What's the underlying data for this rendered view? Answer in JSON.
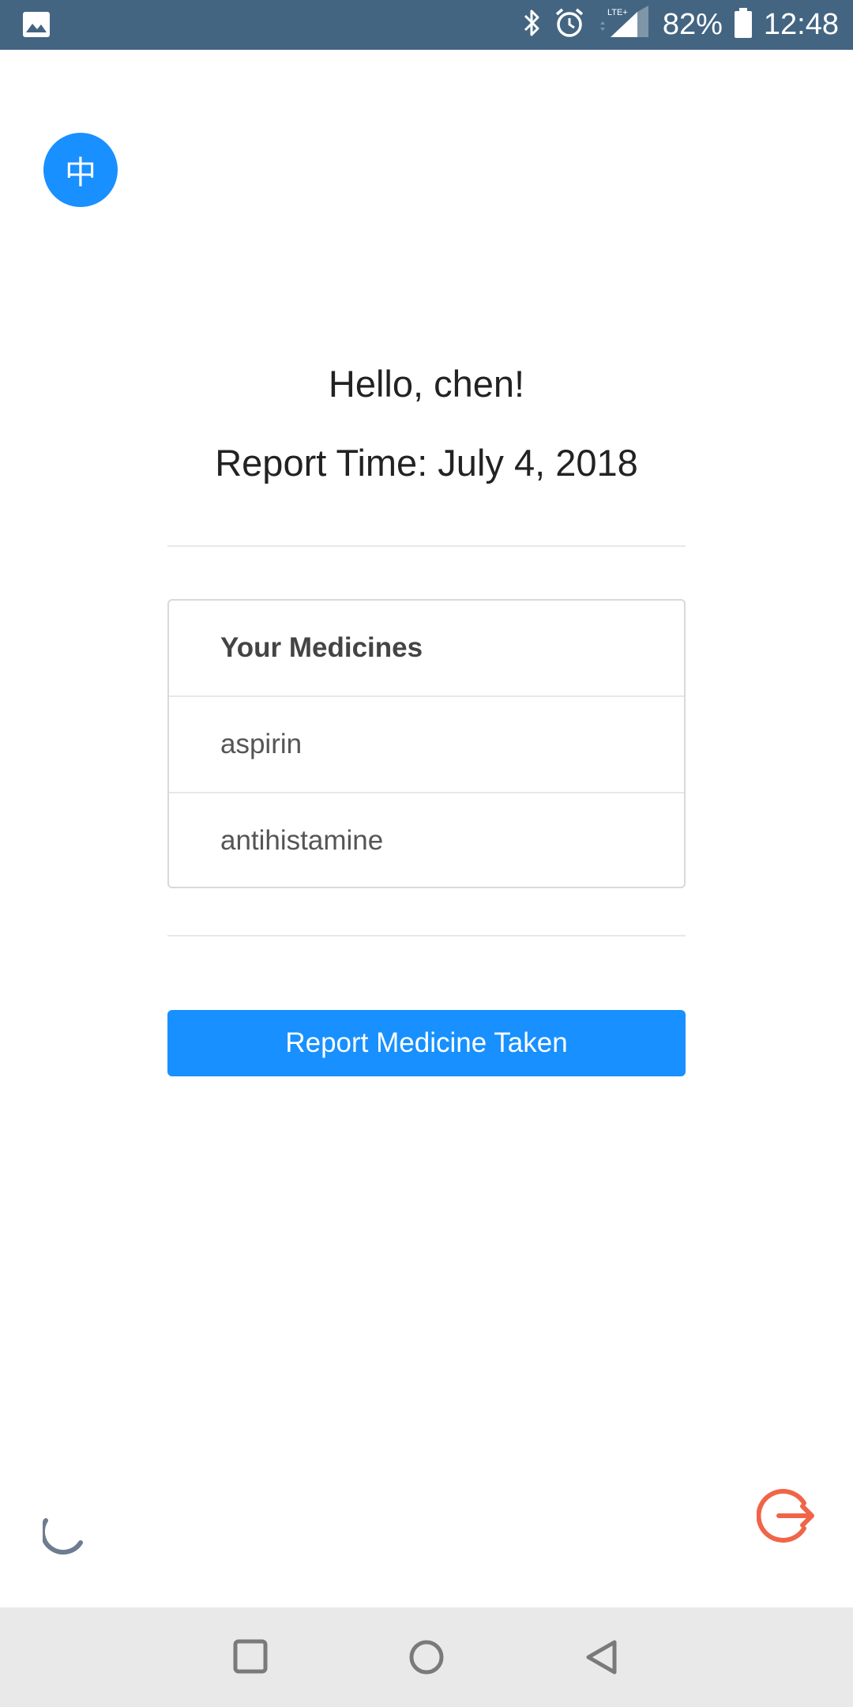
{
  "status_bar": {
    "battery_text": "82%",
    "time": "12:48",
    "network_label": "LTE+",
    "icons": [
      "image-icon",
      "bluetooth-icon",
      "alarm-icon",
      "signal-icon",
      "battery-icon"
    ],
    "background_color": "#436582"
  },
  "language_button": {
    "label": "中",
    "color": "#1890ff"
  },
  "greeting": "Hello, chen!",
  "report_time": "Report Time: July 4, 2018",
  "medicines": {
    "header": "Your Medicines",
    "items": [
      "aspirin",
      "antihistamine"
    ]
  },
  "report_button": {
    "label": "Report Medicine Taken",
    "color": "#1890ff"
  },
  "footer": {
    "spinner_icon": "loading-spinner-icon",
    "logout_icon": "logout-icon",
    "logout_color": "#f06548"
  },
  "nav_bar": {
    "buttons": [
      "recents-button",
      "home-button",
      "back-button"
    ]
  }
}
